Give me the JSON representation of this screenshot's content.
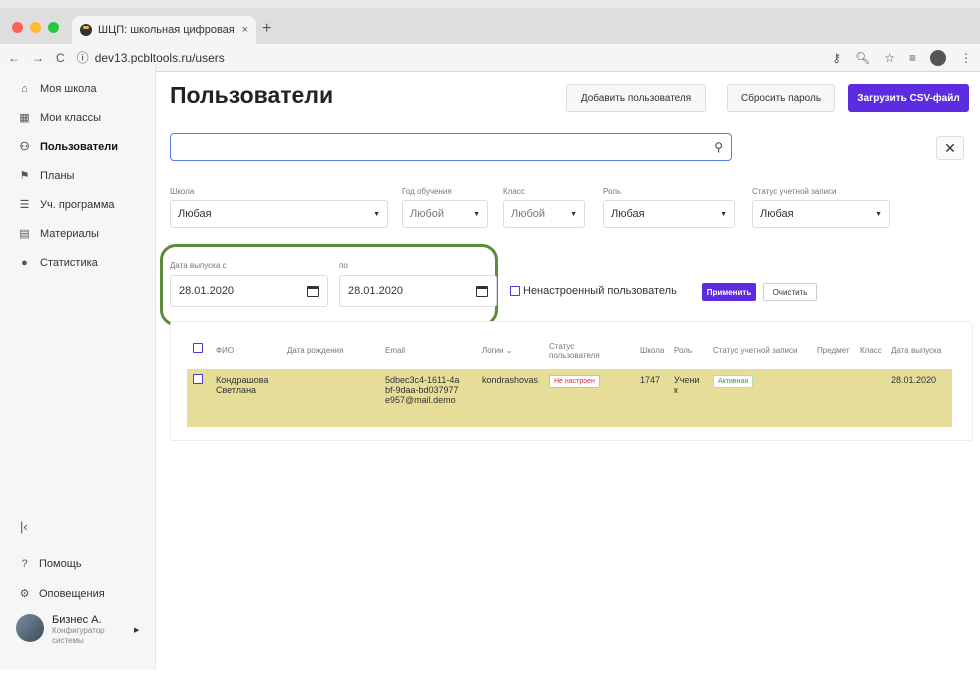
{
  "browser": {
    "tab_title": "ШЦП: школьная цифровая пл",
    "tab_close": "×",
    "new_tab": "+",
    "url": "dev13.pcbltools.ru/users",
    "traffic_lights": [
      "#ff5f57",
      "#febc2e",
      "#28c840"
    ]
  },
  "sidebar": {
    "items": [
      {
        "label": "Моя школа",
        "icon": "school-icon",
        "glyph": "⌂"
      },
      {
        "label": "Мои классы",
        "icon": "classes-icon",
        "glyph": "▦"
      },
      {
        "label": "Пользователи",
        "icon": "users-icon",
        "glyph": "👥"
      },
      {
        "label": "Планы",
        "icon": "flag-icon",
        "glyph": "⚑"
      },
      {
        "label": "Уч. программа",
        "icon": "list-icon",
        "glyph": "☰"
      },
      {
        "label": "Материалы",
        "icon": "document-icon",
        "glyph": "▤"
      },
      {
        "label": "Статистика",
        "icon": "info-icon",
        "glyph": "●"
      }
    ],
    "collapse": "|‹",
    "help": "Помощь",
    "notifications": "Оповещения",
    "user_name": "Бизнес А.",
    "user_role": "Конфигуратор системы"
  },
  "main": {
    "title": "Пользователи",
    "add_user": "Добавить пользователя",
    "reset_password": "Сбросить пароль",
    "upload_csv": "Загрузить CSV-файл",
    "close": "✕"
  },
  "filters": {
    "school_label": "Школа",
    "school_value": "Любая",
    "year_label": "Год обучения",
    "year_value": "Любой",
    "class_label": "Класс",
    "class_value": "Любой",
    "role_label": "Роль",
    "role_value": "Любая",
    "status_label": "Статус учетной записи",
    "status_value": "Любая",
    "grad_from_label": "Дата выпуска с",
    "grad_from_value": "28.01.2020",
    "grad_to_label": "по",
    "grad_to_value": "28.01.2020",
    "unconfigured": "Ненастроенный пользователь",
    "apply": "Применить",
    "clear": "Очистить"
  },
  "table": {
    "headers": {
      "fio": "ФИО",
      "dob": "Дата рождения",
      "email": "Email",
      "login": "Логин ⌄",
      "user_status": "Статус пользователя",
      "school": "Школа",
      "role": "Роль",
      "account_status": "Статус учетной записи",
      "subject": "Предмет",
      "class": "Класс",
      "grad_date": "Дата выпуска"
    },
    "row": {
      "fio": "Кондрашова Светлана",
      "email": "5dbec3c4-1611-4abf-9daa-bd037977e957@mail.demo",
      "login": "kondrashovas",
      "user_status": "Не настроен",
      "school": "1747",
      "role": "Ученик",
      "account_status": "Активная",
      "grad_date": "28.01.2020"
    }
  },
  "colors": {
    "accent": "#5b2ce0",
    "row_highlight": "#e6dd99",
    "annotation_ring": "#5e8a3a",
    "status_bad": "#d0303a",
    "status_good": "#3a9a3a"
  }
}
